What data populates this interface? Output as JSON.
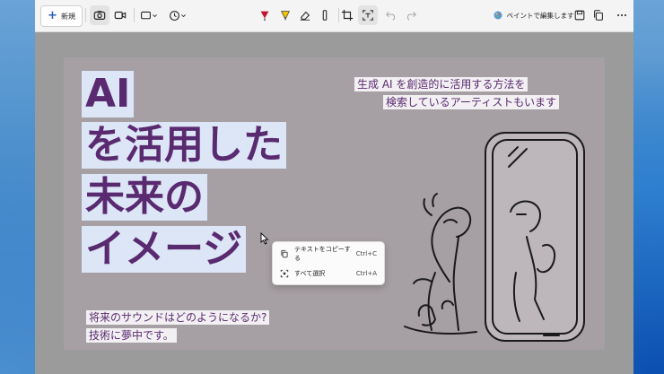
{
  "toolbar": {
    "new_label": "新規",
    "paint_label": "ペイントで編集します"
  },
  "canvas": {
    "headline": [
      "AI",
      "を活用した",
      "未来の",
      "イメージ"
    ],
    "top_caption": [
      "生成 AI を創造的に活用する方法を",
      "検索しているアーティストもいます"
    ],
    "bottom_caption": [
      "将来のサウンドはどのようになるか?",
      "技術に夢中です。"
    ]
  },
  "context_menu": {
    "items": [
      {
        "label": "テキストをコピーする",
        "shortcut": "Ctrl+C"
      },
      {
        "label": "すべて選択",
        "shortcut": "Ctrl+A"
      }
    ]
  },
  "colors": {
    "accent": "#5a2a70",
    "highlight": "#dce6f6",
    "canvas_bg": "#a69fa4"
  }
}
